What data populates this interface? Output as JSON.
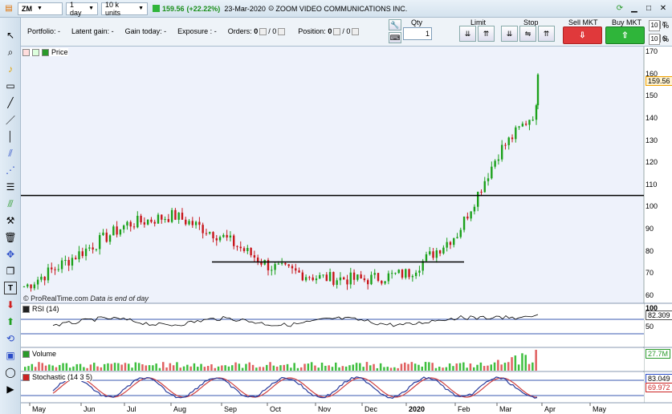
{
  "topbar": {
    "symbol": "ZM",
    "interval": "1 day",
    "units": "10 k units",
    "price": "159.56",
    "change": "(+22.22%)",
    "date": "23-Mar-2020",
    "instrument": "ZOOM VIDEO COMMUNICATIONS INC."
  },
  "portfolio": {
    "portfolio_label": "Portfolio:",
    "portfolio_value": "-",
    "latent_label": "Latent gain:",
    "latent_value": "-",
    "gain_label": "Gain today:",
    "gain_value": "-",
    "exposure_label": "Exposure :",
    "exposure_value": "-",
    "orders_label": "Orders:",
    "orders_a": "0",
    "orders_b": "/ 0",
    "position_label": "Position:",
    "position_a": "0",
    "position_b": "/ 0"
  },
  "order_panel": {
    "qty_label": "Qty",
    "qty_value": "1",
    "limit_label": "Limit",
    "stop_label": "Stop",
    "sell_label": "Sell MKT",
    "buy_label": "Buy MKT",
    "t_label": "T",
    "s_label": "S",
    "t_value": "10",
    "s_value": "10",
    "percent": "%"
  },
  "panels": {
    "price_title": "Price",
    "rsi_title": "RSI (14)",
    "volume_title": "Volume",
    "stoch_title": "Stochastic (14 3 5)",
    "watermark": "© ProRealTime.com",
    "watermark_note": "Data is end of day"
  },
  "axis": {
    "price_ticks": [
      "170",
      "160",
      "150",
      "140",
      "130",
      "120",
      "110",
      "100",
      "90",
      "80",
      "70",
      "60"
    ],
    "price_badge": "159.56",
    "rsi_ticks": [
      "100",
      "50"
    ],
    "rsi_badge": "82.309",
    "vol_badge": "27.7M",
    "stoch_badge1": "83.049",
    "stoch_badge2": "69.972",
    "months": [
      "May",
      "Jun",
      "Jul",
      "Aug",
      "Sep",
      "Oct",
      "Nov",
      "Dec",
      "2020",
      "Feb",
      "Mar",
      "Apr",
      "May"
    ]
  },
  "colors": {
    "up": "#1ba11b",
    "down": "#c8161b",
    "accent": "#f0a000",
    "line": "#000000"
  },
  "chart_data": {
    "type": "line",
    "title": "Price",
    "series": [
      {
        "name": "Price",
        "x": [
          "May",
          "Jun",
          "Jul",
          "Aug",
          "Sep",
          "Oct",
          "Nov",
          "Dec",
          "2020",
          "Feb",
          "Mar"
        ],
        "values": [
          64,
          80,
          92,
          96,
          86,
          73,
          68,
          67,
          70,
          88,
          125
        ]
      }
    ],
    "last_value": 159.56,
    "ylim": [
      60,
      170
    ],
    "hlines": [
      105,
      75
    ]
  }
}
